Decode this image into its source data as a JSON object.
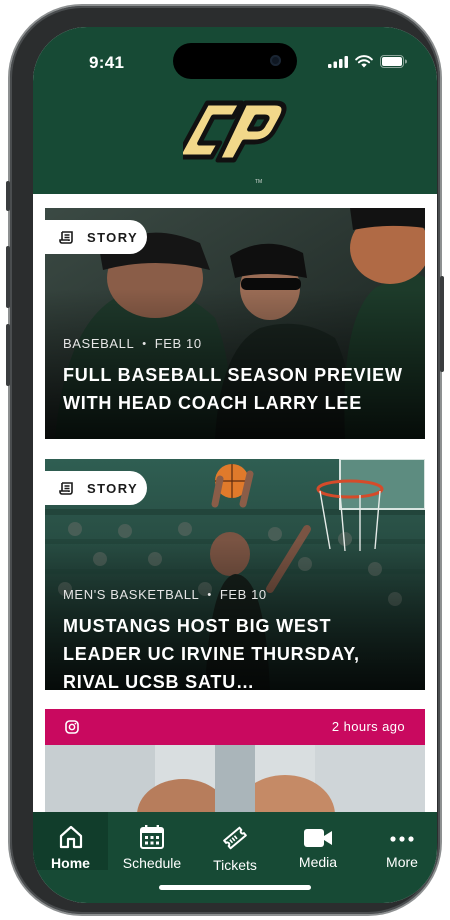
{
  "status_bar": {
    "time": "9:41"
  },
  "header": {
    "logo": "cal-poly-cp-logo",
    "logo_letters": "CP"
  },
  "feed": {
    "cards": [
      {
        "type_label": "STORY",
        "sport": "BASEBALL",
        "date": "FEB 10",
        "headline": "FULL BASEBALL SEASON PREVIEW WITH HEAD COACH LARRY LEE"
      },
      {
        "type_label": "STORY",
        "sport": "MEN'S BASKETBALL",
        "date": "FEB 10",
        "headline": "MUSTANGS HOST BIG WEST LEADER UC IRVINE THURSDAY, RIVAL UCSB SATU…"
      }
    ],
    "social_post": {
      "source_icon": "instagram-icon",
      "time_ago": "2 hours ago"
    }
  },
  "tabbar": {
    "tabs": [
      {
        "label": "Home",
        "icon": "home-icon",
        "active": true
      },
      {
        "label": "Schedule",
        "icon": "calendar-icon",
        "active": false
      },
      {
        "label": "Tickets",
        "icon": "ticket-icon",
        "active": false
      },
      {
        "label": "Media",
        "icon": "video-icon",
        "active": false
      },
      {
        "label": "More",
        "icon": "more-dots-icon",
        "active": false
      }
    ]
  },
  "colors": {
    "brand_green": "#174a35",
    "brand_gold": "#f2d88a",
    "accent_pink": "#c9095f"
  }
}
